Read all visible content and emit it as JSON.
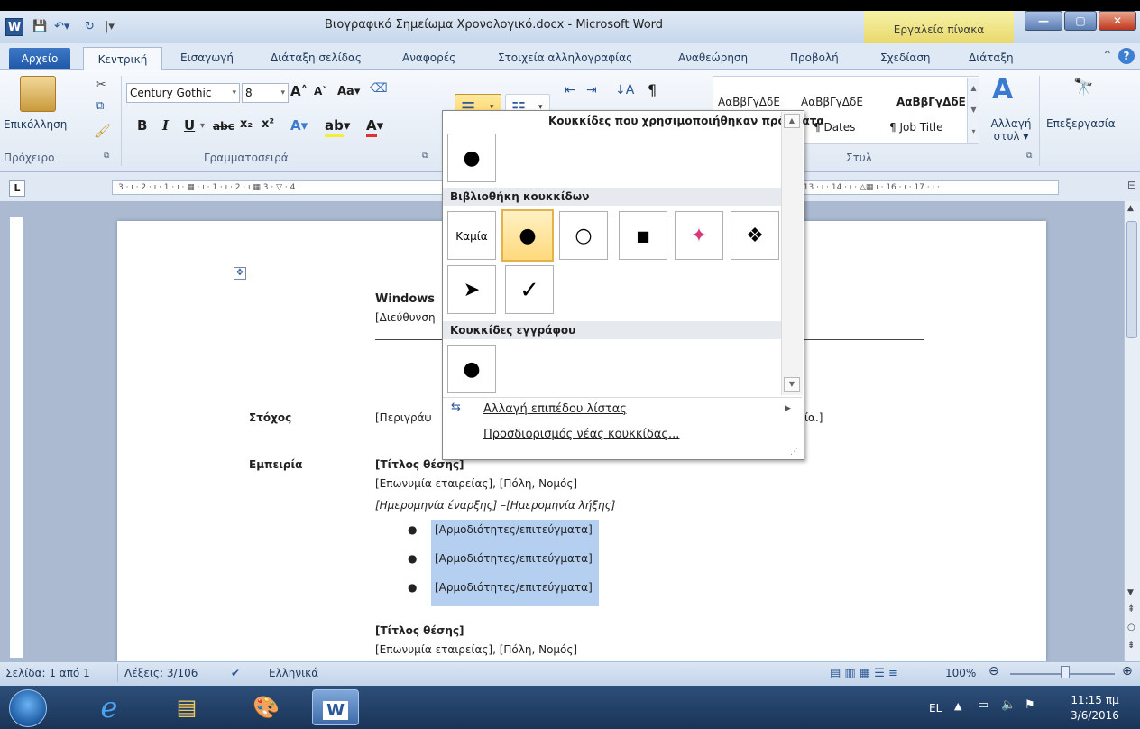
{
  "window": {
    "title": "Βιογραφικό Σημείωμα Χρονολογικό.docx - Microsoft Word",
    "contextual_tab_group": "Εργαλεία πίνακα",
    "app_icon_letter": "W"
  },
  "tabs": [
    {
      "label": "Αρχείο"
    },
    {
      "label": "Κεντρική"
    },
    {
      "label": "Εισαγωγή"
    },
    {
      "label": "Διάταξη σελίδας"
    },
    {
      "label": "Αναφορές"
    },
    {
      "label": "Στοιχεία αλληλογραφίας"
    },
    {
      "label": "Αναθεώρηση"
    },
    {
      "label": "Προβολή"
    },
    {
      "label": "Σχεδίαση"
    },
    {
      "label": "Διάταξη"
    }
  ],
  "ribbon": {
    "clipboard": {
      "paste_label": "Επικόλληση",
      "group_label": "Πρόχειρο"
    },
    "font": {
      "font_name": "Century Gothic",
      "font_size": "8",
      "group_label": "Γραμματοσειρά",
      "case_label": "Aa"
    },
    "styles": {
      "samples": [
        {
          "label": "ΑαΒβΓγΔδΕ",
          "sub": "¶ Dates"
        },
        {
          "label": "ΑαΒβΓγΔδΕ",
          "sub": "¶ Job Title"
        },
        {
          "label": "ΑαΒβΓγΔδΕ",
          "sub": ""
        }
      ],
      "change_styles_label": "Αλλαγή στυλ",
      "group_label": "Στυλ"
    },
    "editing": {
      "label": "Επεξεργασία"
    }
  },
  "ruler": {
    "text": "3 · ı · 2 · ı · 1 · ı · ▦ · ı · 1 · ı · 2 · ı ▦ 3 · ▽ · 4 ·",
    "text_right": "· 13 · ı · 14 · ı · △▦ ı · 16 · ı · 17 · ı ·"
  },
  "document": {
    "header_name": "Windows",
    "header_address": "[Διεύθυνση",
    "objective_label": "Στόχος",
    "objective_text": "[Περιγράψ",
    "objective_tail": "ία.]",
    "experience_label": "Εμπειρία",
    "job_title": "[Τίτλος θέσης]",
    "company_line": "[Επωνυμία εταιρείας], [Πόλη, Νομός]",
    "dates_line": "[Ημερομηνία έναρξης] –[Ημερομηνία λήξης]",
    "bullets": [
      "[Αρμοδιότητες/επιτεύγματα]",
      "[Αρμοδιότητες/επιτεύγματα]",
      "[Αρμοδιότητες/επιτεύγματα]"
    ],
    "job_title_2": "[Τίτλος θέσης]",
    "company_line_2": "[Επωνυμία εταιρείας], [Πόλη, Νομός]"
  },
  "bullet_dropdown": {
    "recent_header": "Κουκκίδες που χρησιμοποιήθηκαν πρόσφατα",
    "library_header": "Βιβλιοθήκη κουκκίδων",
    "document_header": "Κουκκίδες εγγράφου",
    "none_label": "Καμία",
    "library_bullets": [
      "●",
      "○",
      "■",
      "✦",
      "❖",
      "➤",
      "✓"
    ],
    "change_level_label": "Αλλαγή επιπέδου λίστας",
    "define_new_label": "Προσδιορισμός νέας κουκκίδας..."
  },
  "statusbar": {
    "page": "Σελίδα: 1 από 1",
    "words": "Λέξεις: 3/106",
    "language": "Ελληνικά",
    "zoom": "100%"
  },
  "taskbar": {
    "language": "EL",
    "time": "11:15 πμ",
    "date": "3/6/2016"
  },
  "colors": {
    "selection": "#b5cff0",
    "file_tab": "#2b62b4",
    "contextual_tab": "#f0e07a",
    "gallery_selected": "#ffd97c"
  }
}
